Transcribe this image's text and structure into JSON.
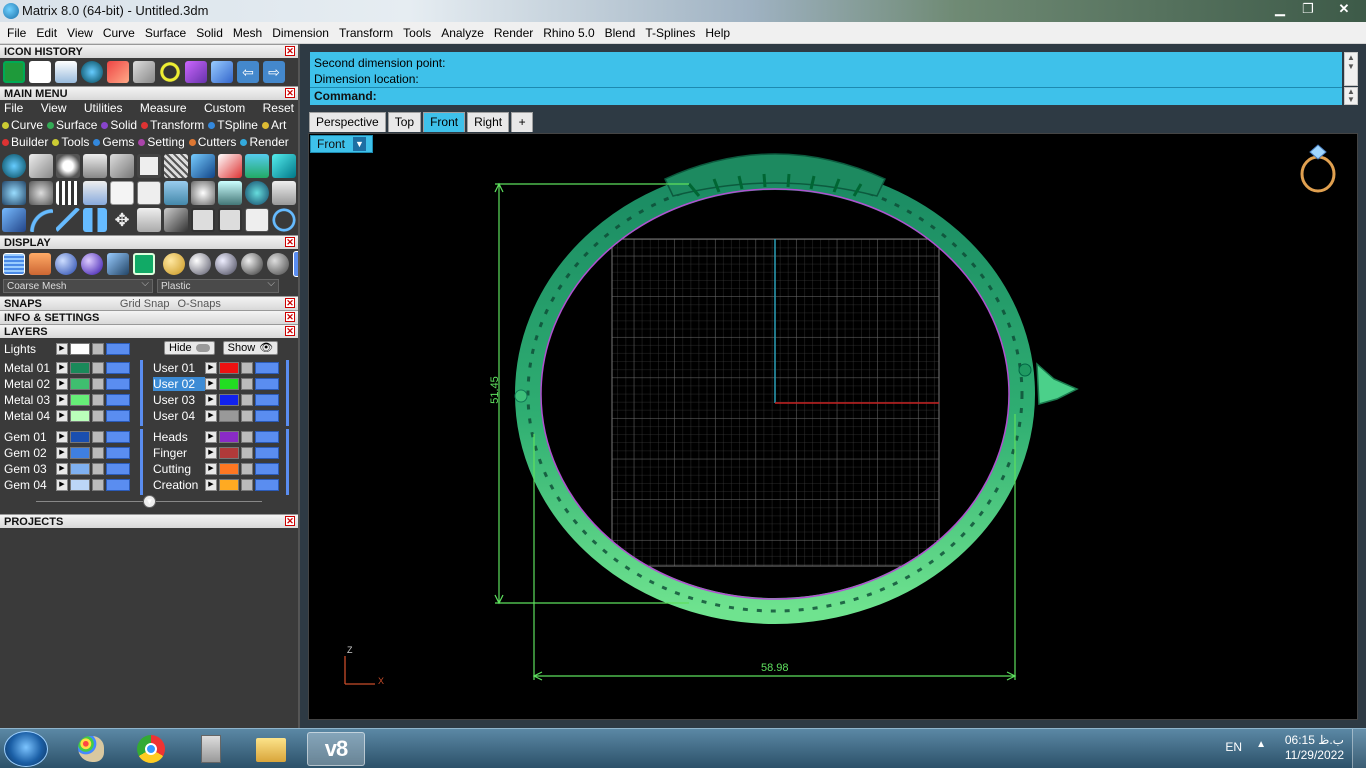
{
  "window": {
    "title": "Matrix 8.0 (64-bit) - Untitled.3dm",
    "buttons": [
      "minimize",
      "restore",
      "close"
    ]
  },
  "menubar": [
    "File",
    "Edit",
    "View",
    "Curve",
    "Surface",
    "Solid",
    "Mesh",
    "Dimension",
    "Transform",
    "Tools",
    "Analyze",
    "Render",
    "Rhino 5.0",
    "Blend",
    "T-Splines",
    "Help"
  ],
  "panel": {
    "icon_history": {
      "title": "ICON HISTORY",
      "icons": [
        "grid-icon",
        "new-file-icon",
        "capture-icon",
        "matrix-logo-icon",
        "pencil-eraser-icon",
        "gumball-icon",
        "ring-gauge-icon",
        "pipe-icon",
        "shape-icon",
        "back-arrow-icon",
        "forward-arrow-icon"
      ]
    },
    "main_menu": {
      "title": "MAIN MENU",
      "links": [
        "File",
        "View",
        "Utilities",
        "Measure",
        "Custom",
        "Reset"
      ],
      "row1": [
        {
          "label": "Curve",
          "color": "#cccc33"
        },
        {
          "label": "Surface",
          "color": "#33aa55"
        },
        {
          "label": "Solid",
          "color": "#8844cc"
        },
        {
          "label": "Transform",
          "color": "#dd3333"
        },
        {
          "label": "TSpline",
          "color": "#3388dd"
        },
        {
          "label": "Art",
          "color": "#ddbb33"
        }
      ],
      "row2": [
        {
          "label": "Builder",
          "color": "#dd3333"
        },
        {
          "label": "Tools",
          "color": "#cccc33"
        },
        {
          "label": "Gems",
          "color": "#3388dd"
        },
        {
          "label": "Setting",
          "color": "#aa44aa"
        },
        {
          "label": "Cutters",
          "color": "#dd7733"
        },
        {
          "label": "Render",
          "color": "#33aadd"
        }
      ]
    },
    "display": {
      "title": "DISPLAY",
      "mesh_select": "Coarse Mesh",
      "material_select": "Plastic"
    },
    "snaps": {
      "title": "SNAPS",
      "grid_snap": "Grid Snap",
      "osnaps": "O-Snaps"
    },
    "info": {
      "title": "INFO & SETTINGS"
    },
    "layers": {
      "title": "LAYERS",
      "lights": "Lights",
      "hide": "Hide",
      "show": "Show",
      "left": [
        {
          "name": "Metal 01",
          "color": "#1a8a5a"
        },
        {
          "name": "Metal 02",
          "color": "#3fbf6f"
        },
        {
          "name": "Metal 03",
          "color": "#66ee77"
        },
        {
          "name": "Metal 04",
          "color": "#bbffbb"
        },
        {
          "name": "Gem 01",
          "color": "#1a4fb0"
        },
        {
          "name": "Gem 02",
          "color": "#3f7fdf"
        },
        {
          "name": "Gem 03",
          "color": "#7fb0ef"
        },
        {
          "name": "Gem 04",
          "color": "#bcd6f7"
        }
      ],
      "right": [
        {
          "name": "User 01",
          "color": "#ee1111"
        },
        {
          "name": "User 02",
          "color": "#22dd22"
        },
        {
          "name": "User 03",
          "color": "#1122ee"
        },
        {
          "name": "User 04",
          "color": "#999999"
        },
        {
          "name": "Heads",
          "color": "#8a2bc6"
        },
        {
          "name": "Finger",
          "color": "#b03a3a"
        },
        {
          "name": "Cutting",
          "color": "#ff7722"
        },
        {
          "name": "Creation",
          "color": "#ffaa22"
        }
      ],
      "selected": "User 02"
    },
    "projects": {
      "title": "PROJECTS"
    }
  },
  "command": {
    "history": [
      "Second dimension point:",
      "Dimension location:"
    ],
    "prompt": "Command:"
  },
  "viewport_tabs": [
    "Perspective",
    "Top",
    "Front",
    "Right",
    "+"
  ],
  "active_tab": "Front",
  "viewport": {
    "label": "Front",
    "dim_vertical": "51.45",
    "dim_horizontal": "58.98",
    "axis_z": "Z",
    "axis_x": "X"
  },
  "taskbar": {
    "apps": [
      "start-orb",
      "paint-icon",
      "chrome-icon",
      "calculator-icon",
      "file-explorer-icon",
      "matrix-v8-icon"
    ],
    "active_app": "matrix-v8-icon",
    "active_app_label": "v8",
    "lang": "EN",
    "time": "06:15 ب.ظ",
    "date": "11/29/2022"
  }
}
